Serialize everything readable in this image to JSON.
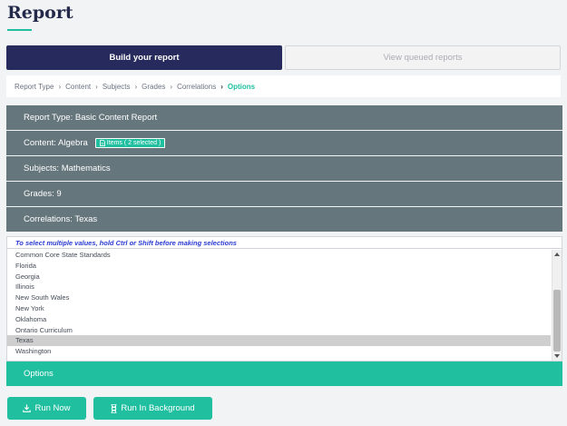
{
  "page": {
    "title": "Report"
  },
  "tabs": {
    "build": "Build your report",
    "queued": "View queued reports"
  },
  "breadcrumb": [
    "Report Type",
    "Content",
    "Subjects",
    "Grades",
    "Correlations",
    "Options"
  ],
  "accordion": {
    "report_type": "Report Type: Basic Content Report",
    "content": "Content: Algebra",
    "content_badge": "Items ( 2 selected )",
    "subjects": "Subjects: Mathematics",
    "grades": "Grades: 9",
    "correlations": "Correlations: Texas"
  },
  "correlations_select": {
    "hint": "To select multiple values, hold Ctrl or Shift before making selections",
    "options": [
      "Common Core State Standards",
      "Florida",
      "Georgia",
      "Illinois",
      "New South Wales",
      "New York",
      "Oklahoma",
      "Ontario Curriculum",
      "Texas",
      "Washington"
    ],
    "selected": "Texas"
  },
  "options_section": {
    "label": "Options"
  },
  "actions": {
    "run_now": "Run Now",
    "run_background": "Run In Background"
  },
  "colors": {
    "accent": "#1fbf9f",
    "navy": "#262a5c",
    "panel": "#66767d",
    "hint": "#2a3bd1"
  }
}
